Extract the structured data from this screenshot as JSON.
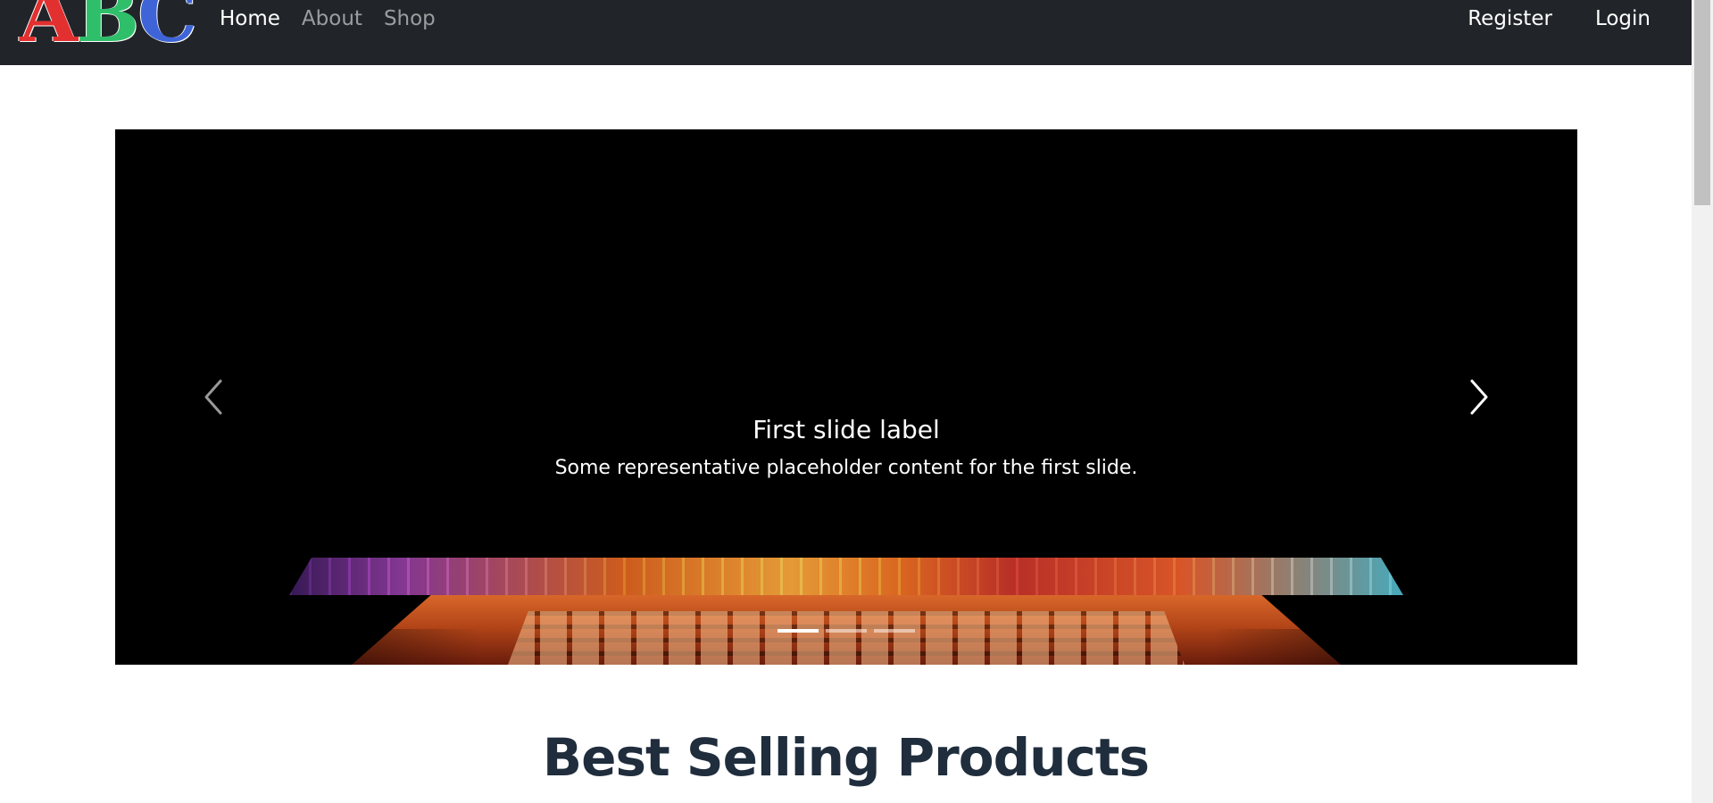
{
  "brand": {
    "letters": [
      "A",
      "B",
      "C"
    ]
  },
  "nav": {
    "left": [
      {
        "label": "Home"
      },
      {
        "label": "About"
      },
      {
        "label": "Shop"
      }
    ],
    "right": [
      {
        "label": "Register"
      },
      {
        "label": "Login"
      }
    ]
  },
  "carousel": {
    "caption_title": "First slide label",
    "caption_text": "Some representative placeholder content for the first slide.",
    "prev_icon": "chevron-left-icon",
    "next_icon": "chevron-right-icon",
    "slide_count": 3,
    "active_slide": 1
  },
  "section": {
    "title": "Best Selling Products"
  },
  "colors": {
    "navbar": "#212529",
    "brand_a": "#e23030",
    "brand_b": "#2fbf6a",
    "brand_c": "#3e64d8",
    "heading": "#1f2d3d"
  }
}
